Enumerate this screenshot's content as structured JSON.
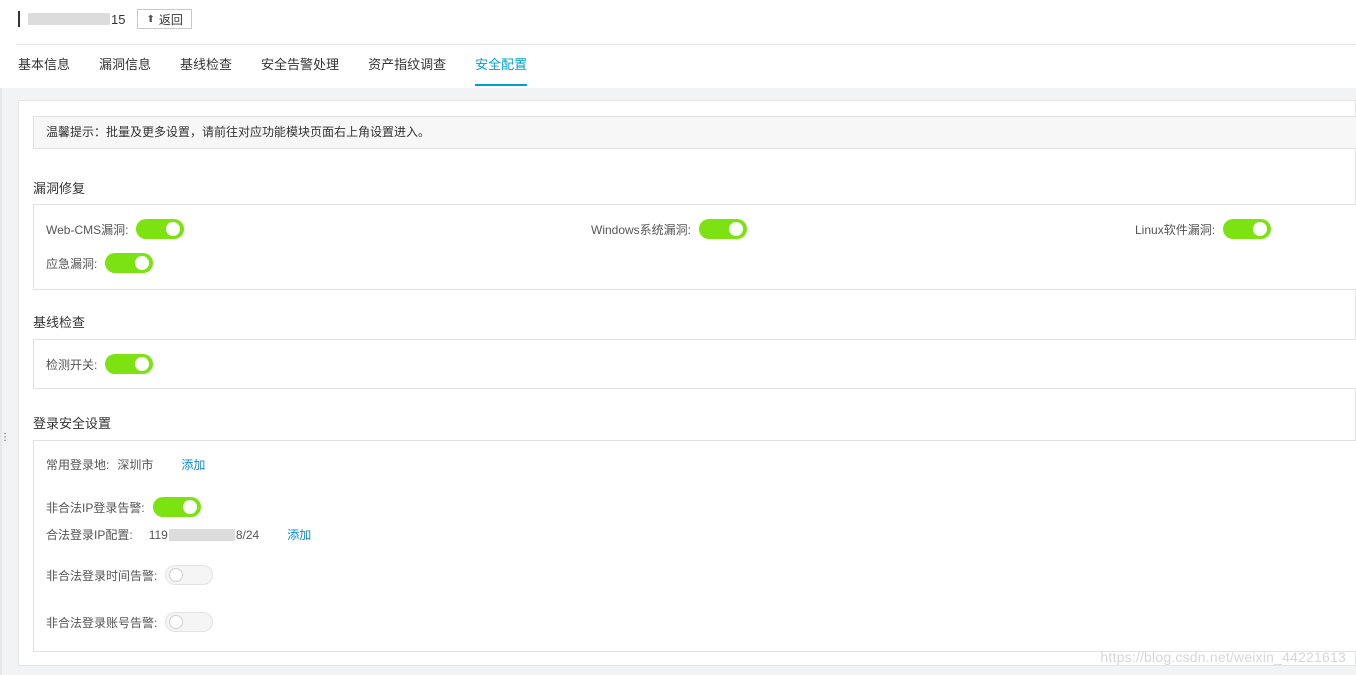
{
  "header": {
    "title_suffix": "15",
    "back_label": "返回"
  },
  "tabs": [
    {
      "label": "基本信息"
    },
    {
      "label": "漏洞信息"
    },
    {
      "label": "基线检查"
    },
    {
      "label": "安全告警处理"
    },
    {
      "label": "资产指纹调查"
    },
    {
      "label": "安全配置",
      "active": true
    }
  ],
  "tip": "温馨提示：批量及更多设置，请前往对应功能模块页面右上角设置进入。",
  "vuln": {
    "title": "漏洞修复",
    "items": [
      {
        "label": "Web-CMS漏洞:",
        "on": true
      },
      {
        "label": "Windows系统漏洞:",
        "on": true
      },
      {
        "label": "Linux软件漏洞:",
        "on": true
      },
      {
        "label": "应急漏洞:",
        "on": true
      }
    ]
  },
  "baseline": {
    "title": "基线检查",
    "items": [
      {
        "label": "检测开关:",
        "on": true
      }
    ]
  },
  "login": {
    "title": "登录安全设置",
    "common_location_label": "常用登录地:",
    "common_location_value": "深圳市",
    "add_label": "添加",
    "illegal_ip_label": "非合法IP登录告警:",
    "illegal_ip_on": true,
    "legal_ip_label": "合法登录IP配置:",
    "legal_ip_prefix": "119",
    "legal_ip_suffix": "8/24",
    "illegal_time_label": "非合法登录时间告警:",
    "illegal_time_on": false,
    "illegal_account_label": "非合法登录账号告警:",
    "illegal_account_on": false
  },
  "watermark": "https://blog.csdn.net/weixin_44221613",
  "colors": {
    "accent": "#00a2ca",
    "toggle_on": "#7ce212",
    "link": "#0a8bd6"
  }
}
